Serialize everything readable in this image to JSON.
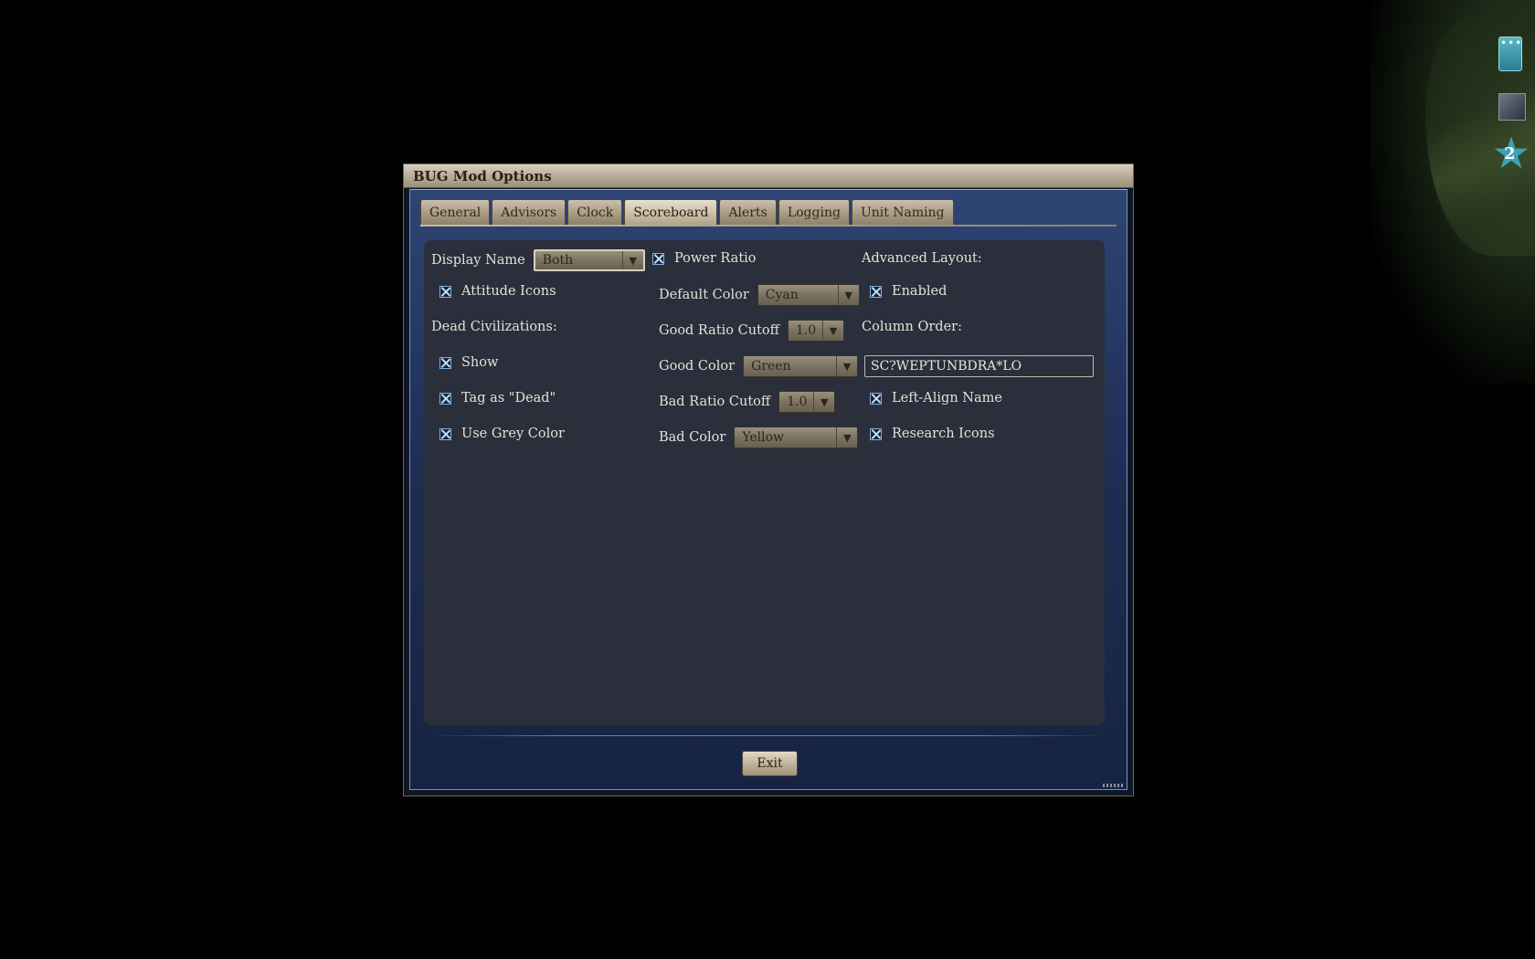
{
  "window": {
    "title": "BUG Mod Options",
    "tabs": [
      {
        "label": "General"
      },
      {
        "label": "Advisors"
      },
      {
        "label": "Clock"
      },
      {
        "label": "Scoreboard",
        "active": true
      },
      {
        "label": "Alerts"
      },
      {
        "label": "Logging"
      },
      {
        "label": "Unit Naming"
      }
    ],
    "exit_label": "Exit"
  },
  "map": {
    "unit_badge": "2"
  },
  "col1": {
    "display_name_label": "Display Name",
    "display_name_value": "Both",
    "attitude_icons_label": "Attitude Icons",
    "attitude_icons_checked": true,
    "dead_civs_label": "Dead Civilizations:",
    "show_label": "Show",
    "show_checked": true,
    "tag_dead_label": "Tag as \"Dead\"",
    "tag_dead_checked": true,
    "use_grey_label": "Use Grey Color",
    "use_grey_checked": true
  },
  "col2": {
    "power_ratio_label": "Power Ratio",
    "power_ratio_checked": true,
    "default_color_label": "Default Color",
    "default_color_value": "Cyan",
    "good_ratio_label": "Good Ratio Cutoff",
    "good_ratio_value": "1.0",
    "good_color_label": "Good Color",
    "good_color_value": "Green",
    "bad_ratio_label": "Bad Ratio Cutoff",
    "bad_ratio_value": "1.0",
    "bad_color_label": "Bad Color",
    "bad_color_value": "Yellow"
  },
  "col3": {
    "advanced_layout_label": "Advanced Layout:",
    "enabled_label": "Enabled",
    "enabled_checked": true,
    "column_order_label": "Column Order:",
    "column_order_value": "SC?WEPTUNBDRA*LO",
    "left_align_label": "Left-Align Name",
    "left_align_checked": true,
    "research_icons_label": "Research Icons",
    "research_icons_checked": true
  }
}
